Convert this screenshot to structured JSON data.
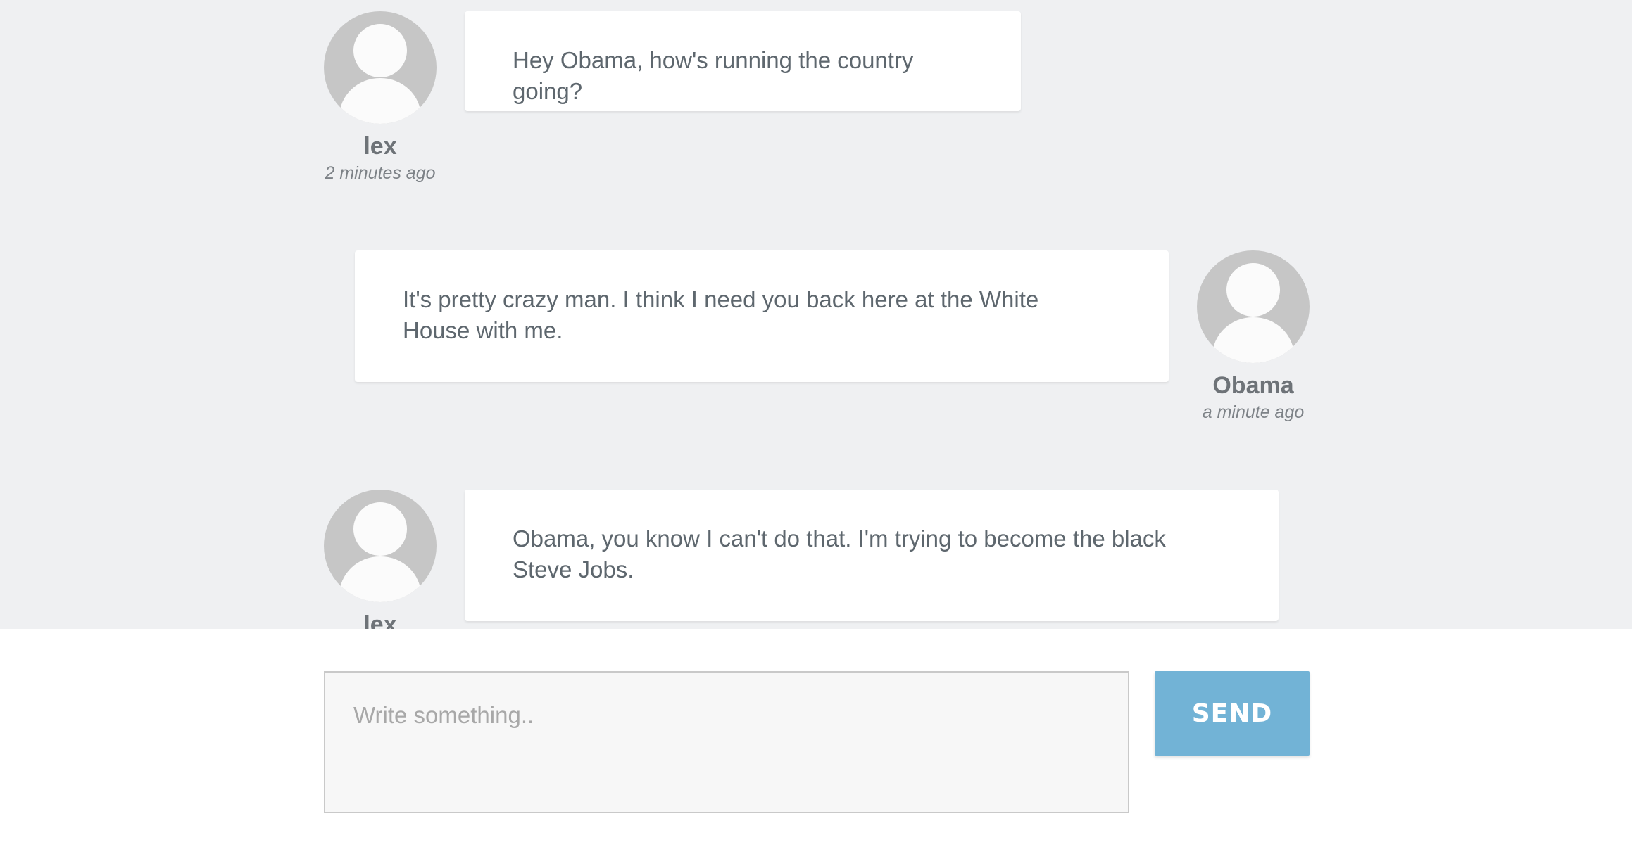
{
  "messages": [
    {
      "author": "lex",
      "time": "2 minutes ago",
      "text": "Hey Obama, how's running the country going?",
      "side": "left"
    },
    {
      "author": "Obama",
      "time": "a minute ago",
      "text": "It's pretty crazy man. I think I need you back here at the White House with me.",
      "side": "right"
    },
    {
      "author": "lex",
      "time": "",
      "text": "Obama, you know I can't do that. I'm trying to become the black Steve Jobs.",
      "side": "left"
    }
  ],
  "composer": {
    "placeholder": "Write something..",
    "value": "",
    "send_label": "SEND"
  },
  "icons": {
    "avatar": "user-silhouette-icon"
  },
  "colors": {
    "chat_background": "#eff0f2",
    "bubble_background": "#ffffff",
    "avatar_background": "#c6c6c6",
    "text": "#5e676e",
    "send_button": "#72b3d6"
  }
}
